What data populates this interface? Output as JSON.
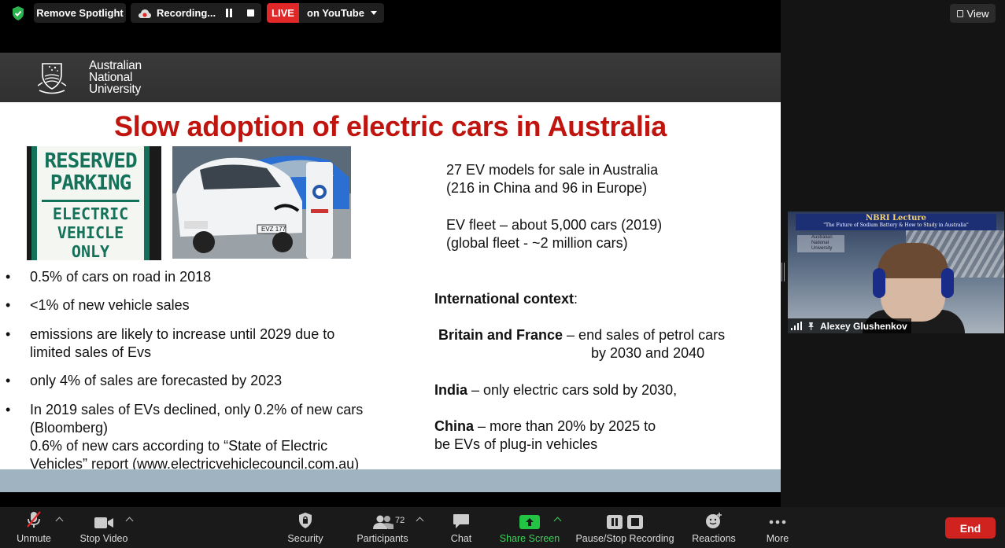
{
  "topbar": {
    "spotlight_label": "Remove Spotlight",
    "recording_label": "Recording...",
    "live_label": "LIVE",
    "stream_target": "on YouTube",
    "view_label": "View"
  },
  "video_tile": {
    "banner_title": "NBRI Lecture",
    "banner_subtitle": "\"The Future of Sodium Battery & How to Study in Australia\"",
    "participant_name": "Alexey Glushenkov"
  },
  "slide": {
    "org_line1": "Australian",
    "org_line2": "National",
    "org_line3": "University",
    "title": "Slow adoption of electric cars in Australia",
    "sign": {
      "line1": "RESERVED",
      "line2": "PARKING",
      "line3": "ELECTRIC",
      "line4": "VEHICLE",
      "line5": "ONLY"
    },
    "plate_text": "EVZ 177",
    "bullet_char": "•",
    "bullets": [
      {
        "lines": [
          "0.5% of cars on road in 2018"
        ]
      },
      {
        "lines": [
          "<1% of new vehicle sales"
        ]
      },
      {
        "lines": [
          "emissions are likely to increase until 2029 due to",
          "limited sales of Evs"
        ]
      },
      {
        "lines": [
          "only 4% of sales are forecasted by 2023"
        ]
      },
      {
        "lines": [
          "In 2019 sales of EVs declined, only 0.2% of new cars",
          "(Bloomberg)",
          " 0.6% of new cars according to “State of Electric",
          " Vehicles” report   (www.electricvehiclecouncil.com.au)"
        ]
      }
    ],
    "right": {
      "models_line1": "27 EV models for sale in Australia",
      "models_line2": "(216 in China and 96 in Europe)",
      "fleet_line1": "EV fleet – about 5,000 cars (2019)",
      "fleet_line2": "(global fleet - ~2 million cars)",
      "intl_heading": "International context",
      "intl_colon": ":",
      "bf_bold": "Britain and France",
      "bf_text": " – end sales of petrol cars",
      "bf_text2": "by 2030 and 2040",
      "india_bold": "India",
      "india_text": " – only electric cars sold by 2030,",
      "china_bold": "China",
      "china_text": " – more than 20% by 2025 to",
      "china_text2": "be EVs of plug-in vehicles"
    }
  },
  "toolbar": {
    "unmute": "Unmute",
    "stop_video": "Stop Video",
    "security": "Security",
    "participants": "Participants",
    "participant_count": "72",
    "chat": "Chat",
    "share_screen": "Share Screen",
    "pause_stop_recording": "Pause/Stop Recording",
    "reactions": "Reactions",
    "more": "More",
    "end": "End"
  },
  "colors": {
    "live_red": "#e02828",
    "title_red": "#c0140f",
    "share_green": "#3fcf5c",
    "end_red": "#d0231f"
  }
}
